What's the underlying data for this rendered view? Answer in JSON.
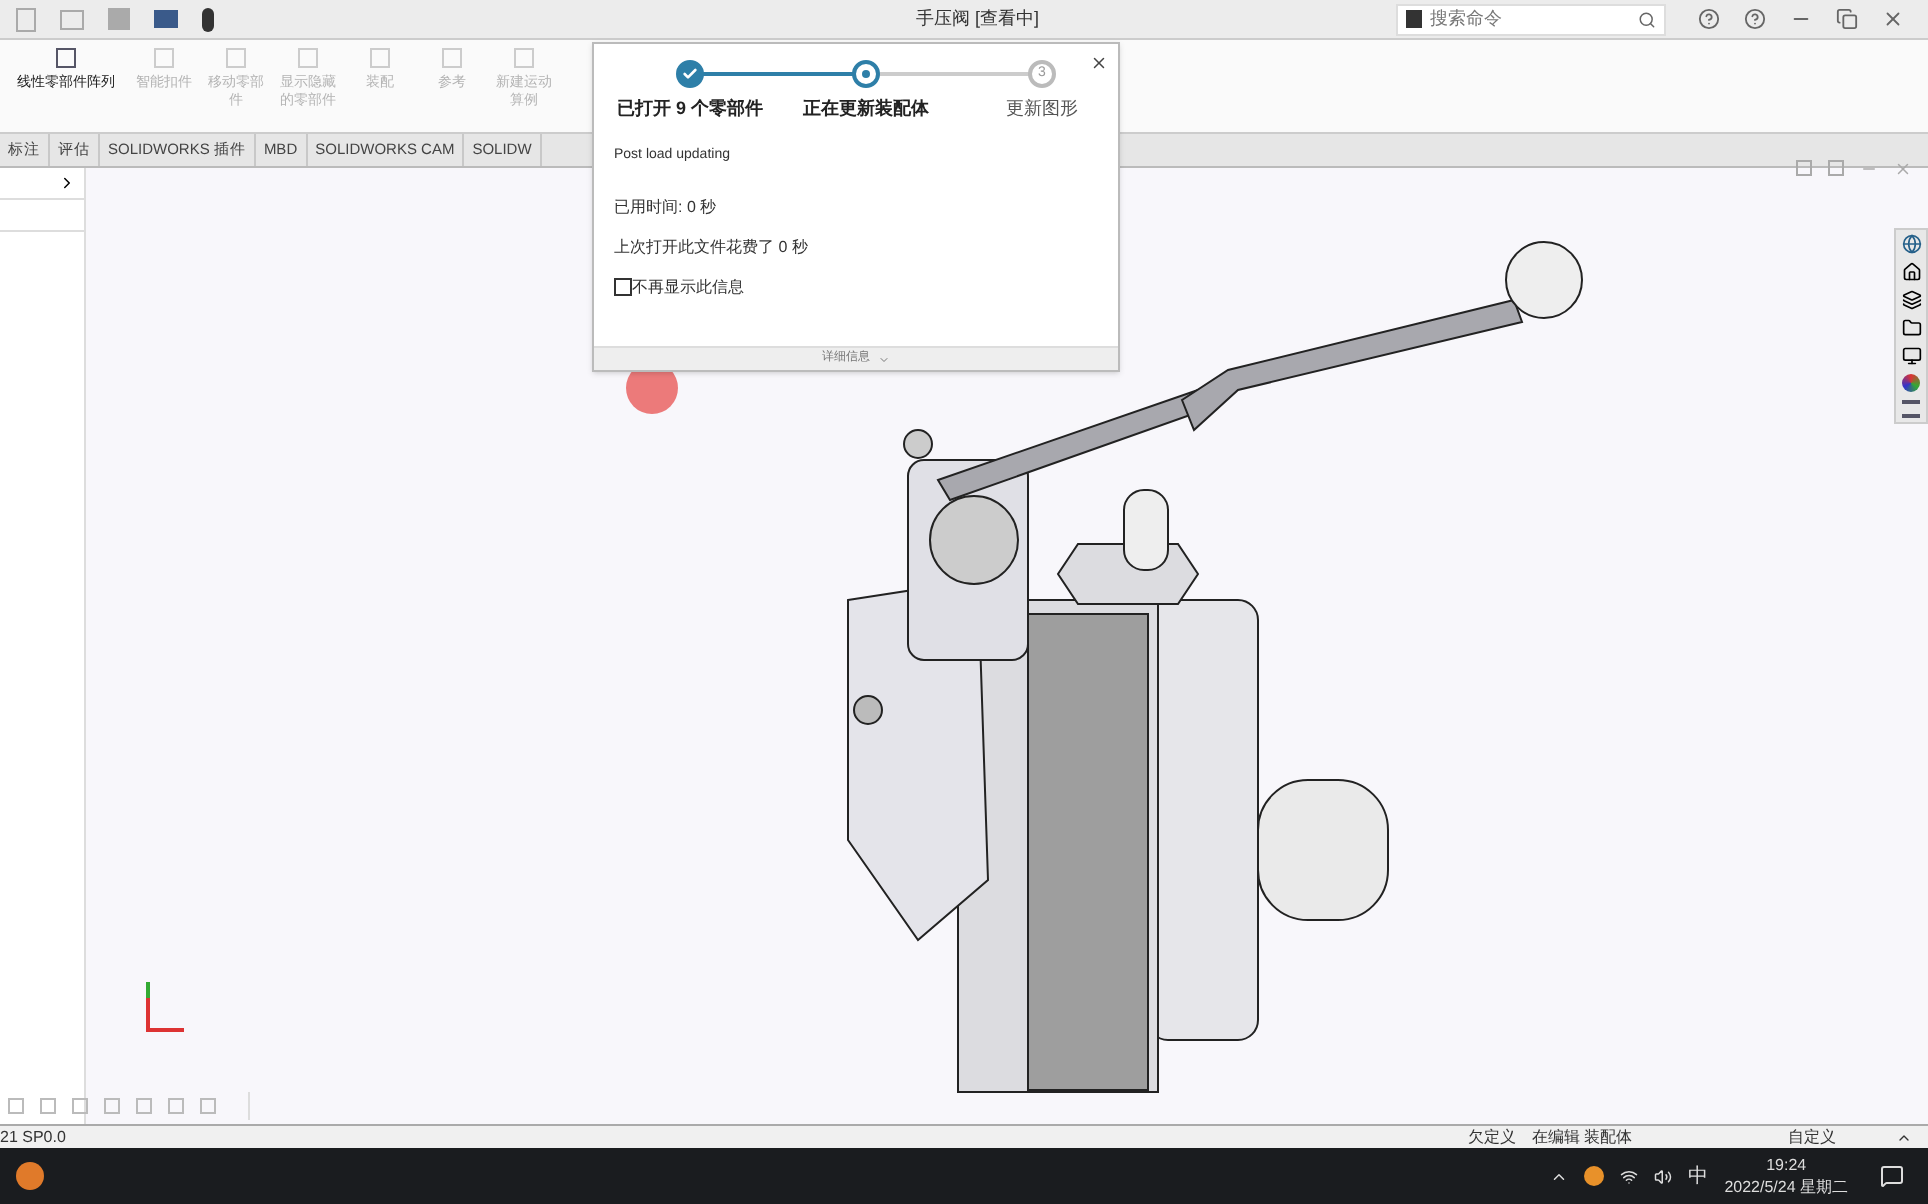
{
  "window": {
    "title": "手压阀 [查看中]",
    "search": {
      "placeholder": "搜索命令"
    }
  },
  "ribbon": {
    "buttons": [
      {
        "label": "线性零部件阵列",
        "disabled": false
      },
      {
        "label": "智能扣件",
        "disabled": true
      },
      {
        "label": "移动零部件",
        "disabled": true
      },
      {
        "label": "显示隐藏的零部件",
        "disabled": true
      },
      {
        "label": "装配",
        "disabled": true
      },
      {
        "label": "参考",
        "disabled": true
      },
      {
        "label": "新建运动算例",
        "disabled": true
      }
    ]
  },
  "tabs": [
    {
      "label": "标注",
      "selected": false
    },
    {
      "label": "评估",
      "selected": false
    },
    {
      "label": "SOLIDWORKS 插件",
      "selected": false
    },
    {
      "label": "MBD",
      "selected": false
    },
    {
      "label": "SOLIDWORKS CAM",
      "selected": false
    },
    {
      "label": "SOLIDW",
      "selected": false
    }
  ],
  "dialog": {
    "steps": [
      {
        "label": "已打开 9 个零部件",
        "completed": true,
        "active": false
      },
      {
        "label": "正在更新装配体",
        "completed": false,
        "active": true
      },
      {
        "label": "更新图形",
        "completed": false,
        "active": false,
        "number": "3"
      }
    ],
    "message": "Post load updating",
    "elapsed": "已用时间: 0 秒",
    "last_time": "上次打开此文件花费了 0 秒",
    "checkbox": {
      "label": "不再显示此信息",
      "checked": false
    },
    "footer": "详细信息"
  },
  "status_bar": {
    "version": "21 SP0.0",
    "items": [
      "欠定义",
      "在编辑 装配体",
      "自定义"
    ]
  },
  "taskbar": {
    "ime": "中",
    "time": "19:24",
    "date": "2022/5/24 星期二"
  }
}
